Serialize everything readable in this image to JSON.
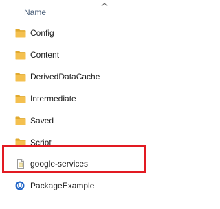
{
  "header": {
    "name_label": "Name"
  },
  "items": [
    {
      "label": "Config",
      "icon": "folder-icon"
    },
    {
      "label": "Content",
      "icon": "folder-icon"
    },
    {
      "label": "DerivedDataCache",
      "icon": "folder-icon"
    },
    {
      "label": "Intermediate",
      "icon": "folder-icon"
    },
    {
      "label": "Saved",
      "icon": "folder-icon"
    },
    {
      "label": "Script",
      "icon": "folder-icon"
    },
    {
      "label": "google-services",
      "icon": "json-file-icon"
    },
    {
      "label": "PackageExample",
      "icon": "unreal-project-icon"
    }
  ],
  "colors": {
    "folder_yellow": "#f4c04f",
    "folder_tab": "#e0a92e",
    "highlight_red": "#e21a22",
    "header_text": "#4c607a"
  }
}
